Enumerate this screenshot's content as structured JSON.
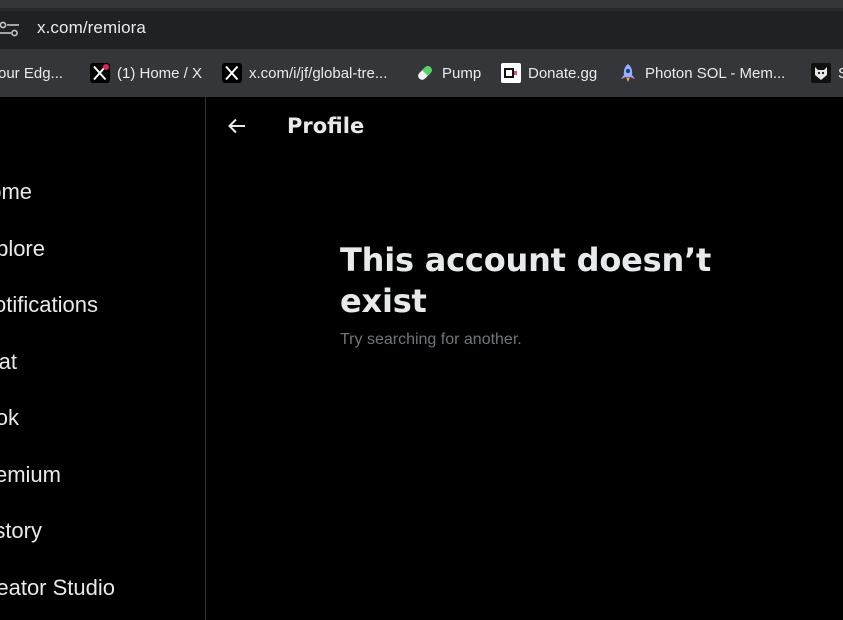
{
  "browser": {
    "url": "x.com/remiora",
    "bookmarks": [
      {
        "label": "our Edg...",
        "icon": "edge-icon"
      },
      {
        "label": "(1) Home / X",
        "icon": "x-logo-icon"
      },
      {
        "label": "x.com/i/jf/global-tre...",
        "icon": "x-logo-icon"
      },
      {
        "label": "Pump",
        "icon": "pill-icon"
      },
      {
        "label": "Donate.gg",
        "icon": "donate-icon"
      },
      {
        "label": "Photon SOL - Mem...",
        "icon": "rocket-icon"
      },
      {
        "label": "S",
        "icon": "wolf-icon"
      }
    ]
  },
  "sidebar": {
    "items": [
      {
        "label": "ome"
      },
      {
        "label": "plore"
      },
      {
        "label": "otifications"
      },
      {
        "label": "hat"
      },
      {
        "label": "ok"
      },
      {
        "label": "emium"
      },
      {
        "label": "story"
      },
      {
        "label": "eator Studio"
      }
    ]
  },
  "header": {
    "title": "Profile"
  },
  "empty_state": {
    "title": "This account doesn’t exist",
    "subtitle": "Try searching for another."
  },
  "colors": {
    "background": "#000000",
    "text_primary": "#e7e9ea",
    "text_secondary": "#71767b",
    "divider": "#2f3336",
    "chrome_dark": "#202124",
    "chrome_mid": "#35363a"
  }
}
